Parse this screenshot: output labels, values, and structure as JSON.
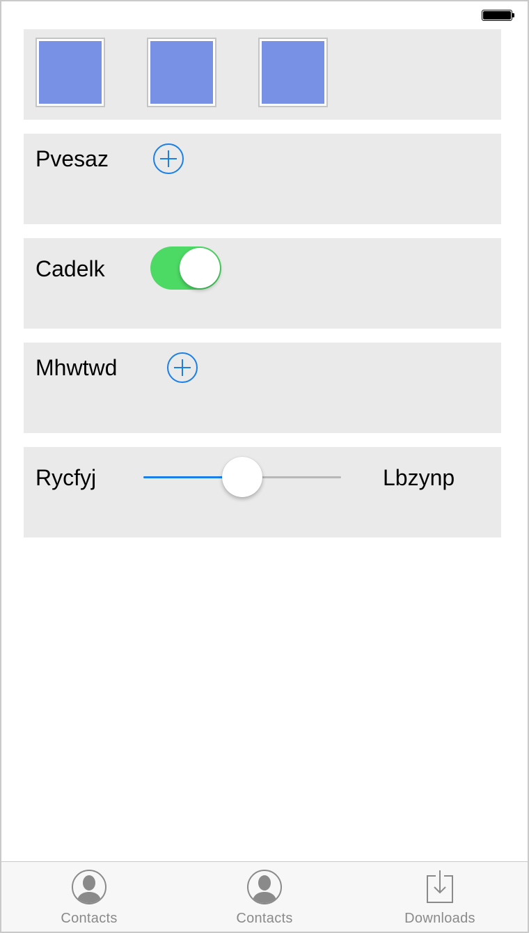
{
  "status_bar": {
    "battery_icon": "battery-full-icon"
  },
  "image_row": {
    "thumbnails": [
      {
        "icon": "image-thumbnail",
        "color": "#7891e4"
      },
      {
        "icon": "image-thumbnail",
        "color": "#7891e4"
      },
      {
        "icon": "image-thumbnail",
        "color": "#7891e4"
      }
    ]
  },
  "rows": {
    "pvesaz": {
      "label": "Pvesaz",
      "button_icon": "plus-circle-icon"
    },
    "cadelk": {
      "label": "Cadelk",
      "toggle_on": true,
      "toggle_color": "#4cd964"
    },
    "mhwtwd": {
      "label": "Mhwtwd",
      "button_icon": "plus-circle-icon"
    },
    "rycfyj": {
      "label": "Rycfyj",
      "slider_value": 0.5,
      "trailing_label": "Lbzynp",
      "accent": "#1a7fe6"
    }
  },
  "tabbar": {
    "tabs": [
      {
        "label": "Contacts",
        "icon": "contact-icon"
      },
      {
        "label": "Contacts",
        "icon": "contact-icon"
      },
      {
        "label": "Downloads",
        "icon": "download-icon"
      }
    ]
  }
}
